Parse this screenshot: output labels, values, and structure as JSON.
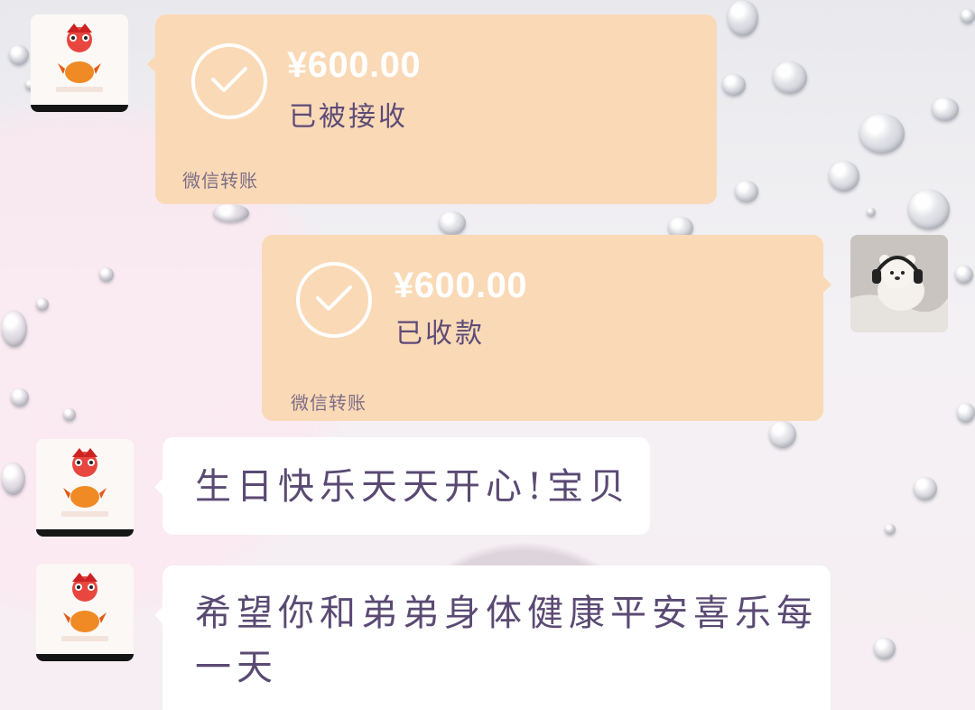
{
  "messages": [
    {
      "type": "transfer",
      "side": "left",
      "amount": "¥600.00",
      "status": "已被接收",
      "label": "微信转账"
    },
    {
      "type": "transfer",
      "side": "right",
      "amount": "¥600.00",
      "status": "已收款",
      "label": "微信转账"
    },
    {
      "type": "text",
      "side": "left",
      "text": "生日快乐天天开心!宝贝"
    },
    {
      "type": "text",
      "side": "left",
      "text_line1": "希望你和弟弟身体健康平安喜乐每",
      "text_line2": "一天"
    }
  ],
  "icons": {
    "contact_avatar": "chicken-avatar-icon",
    "self_avatar": "bear-headphones-avatar-icon",
    "check": "check-circle-icon"
  },
  "colors": {
    "transfer_bubble": "#fad9b6",
    "text_bubble": "#ffffff",
    "handwriting": "#5a4a73"
  }
}
